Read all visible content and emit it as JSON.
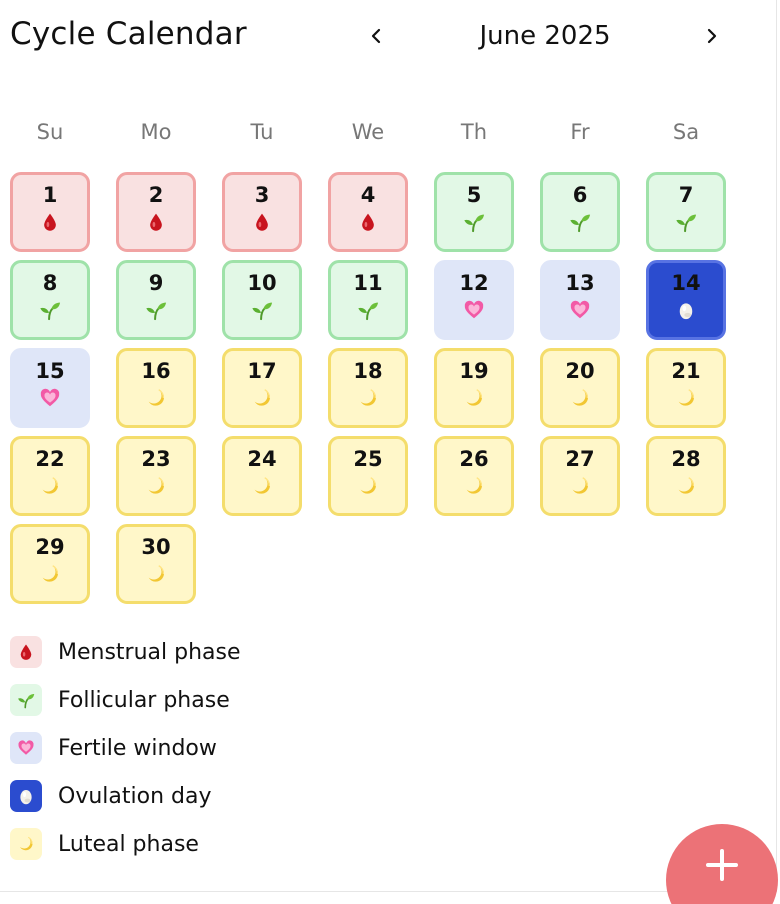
{
  "header": {
    "title": "Cycle Calendar",
    "month": "June 2025"
  },
  "weekdays": [
    "Su",
    "Mo",
    "Tu",
    "We",
    "Th",
    "Fr",
    "Sa"
  ],
  "days": [
    {
      "num": "1",
      "phase": "menstrual"
    },
    {
      "num": "2",
      "phase": "menstrual"
    },
    {
      "num": "3",
      "phase": "menstrual"
    },
    {
      "num": "4",
      "phase": "menstrual"
    },
    {
      "num": "5",
      "phase": "follicular"
    },
    {
      "num": "6",
      "phase": "follicular"
    },
    {
      "num": "7",
      "phase": "follicular"
    },
    {
      "num": "8",
      "phase": "follicular"
    },
    {
      "num": "9",
      "phase": "follicular"
    },
    {
      "num": "10",
      "phase": "follicular"
    },
    {
      "num": "11",
      "phase": "follicular"
    },
    {
      "num": "12",
      "phase": "fertile"
    },
    {
      "num": "13",
      "phase": "fertile"
    },
    {
      "num": "14",
      "phase": "ovulation"
    },
    {
      "num": "15",
      "phase": "fertile"
    },
    {
      "num": "16",
      "phase": "luteal"
    },
    {
      "num": "17",
      "phase": "luteal"
    },
    {
      "num": "18",
      "phase": "luteal"
    },
    {
      "num": "19",
      "phase": "luteal"
    },
    {
      "num": "20",
      "phase": "luteal"
    },
    {
      "num": "21",
      "phase": "luteal"
    },
    {
      "num": "22",
      "phase": "luteal"
    },
    {
      "num": "23",
      "phase": "luteal"
    },
    {
      "num": "24",
      "phase": "luteal"
    },
    {
      "num": "25",
      "phase": "luteal"
    },
    {
      "num": "26",
      "phase": "luteal"
    },
    {
      "num": "27",
      "phase": "luteal"
    },
    {
      "num": "28",
      "phase": "luteal"
    },
    {
      "num": "29",
      "phase": "luteal"
    },
    {
      "num": "30",
      "phase": "luteal"
    }
  ],
  "legend": [
    {
      "phase": "menstrual",
      "label": "Menstrual phase",
      "icon": "blood-drop-icon"
    },
    {
      "phase": "follicular",
      "label": "Follicular phase",
      "icon": "seedling-icon"
    },
    {
      "phase": "fertile",
      "label": "Fertile window",
      "icon": "heart-icon"
    },
    {
      "phase": "ovulation",
      "label": "Ovulation day",
      "icon": "egg-icon"
    },
    {
      "phase": "luteal",
      "label": "Luteal phase",
      "icon": "moon-icon"
    }
  ],
  "colors": {
    "menstrual": "#f9e1e1",
    "follicular": "#e2f8e6",
    "fertile": "#dfe6f8",
    "ovulation": "#2b4ccf",
    "luteal": "#fff7c9",
    "fab": "#ec7277"
  },
  "icons": {
    "prev": "chevron-left-icon",
    "next": "chevron-right-icon",
    "fab": "plus-icon"
  }
}
